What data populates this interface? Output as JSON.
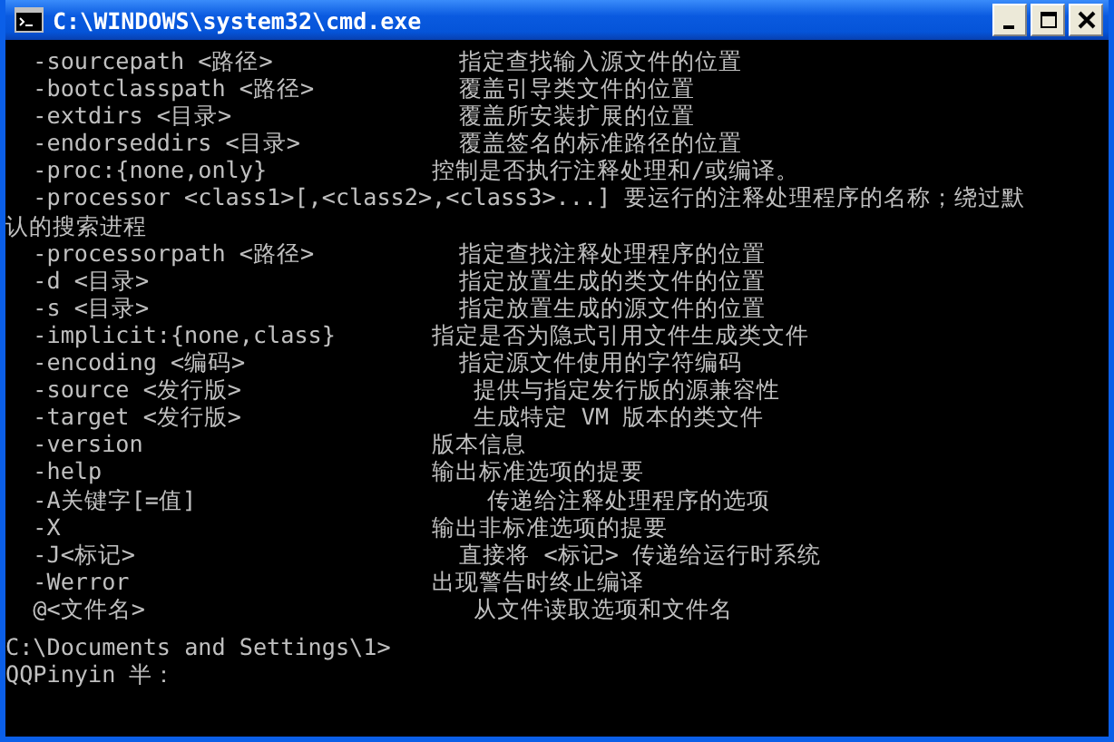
{
  "window": {
    "title": "C:\\WINDOWS\\system32\\cmd.exe"
  },
  "lines": [
    {
      "kind": "option",
      "option": "-sourcepath <路径>",
      "description": "  指定查找输入源文件的位置"
    },
    {
      "kind": "option",
      "option": "-bootclasspath <路径>",
      "description": "  覆盖引导类文件的位置"
    },
    {
      "kind": "option",
      "option": "-extdirs <目录>",
      "description": "  覆盖所安装扩展的位置"
    },
    {
      "kind": "option",
      "option": "-endorseddirs <目录>",
      "description": "  覆盖签名的标准路径的位置"
    },
    {
      "kind": "option",
      "option": "-proc:{none,only}",
      "description": "控制是否执行注释处理和/或编译。"
    },
    {
      "kind": "wrap",
      "option": "-processor <class1>[,<class2>,<class3>...]",
      "description": "要运行的注释处理程序的名称；绕过默",
      "continuation": "认的搜索进程"
    },
    {
      "kind": "option",
      "option": "-processorpath <路径>",
      "description": "  指定查找注释处理程序的位置"
    },
    {
      "kind": "option",
      "option": "-d <目录>",
      "description": "  指定放置生成的类文件的位置"
    },
    {
      "kind": "option",
      "option": "-s <目录>",
      "description": "  指定放置生成的源文件的位置"
    },
    {
      "kind": "option",
      "option": "-implicit:{none,class}",
      "description": "指定是否为隐式引用文件生成类文件"
    },
    {
      "kind": "option",
      "option": "-encoding <编码>",
      "description": "  指定源文件使用的字符编码"
    },
    {
      "kind": "option",
      "option": "-source <发行版>",
      "description": "   提供与指定发行版的源兼容性"
    },
    {
      "kind": "option",
      "option": "-target <发行版>",
      "description": "   生成特定 VM 版本的类文件"
    },
    {
      "kind": "option",
      "option": "-version",
      "description": "版本信息"
    },
    {
      "kind": "option",
      "option": "-help",
      "description": "输出标准选项的提要"
    },
    {
      "kind": "option",
      "option": "-A关键字[=值]",
      "description": "    传递给注释处理程序的选项"
    },
    {
      "kind": "option",
      "option": "-X",
      "description": "输出非标准选项的提要"
    },
    {
      "kind": "option",
      "option": "-J<标记>",
      "description": "  直接将 <标记> 传递给运行时系统"
    },
    {
      "kind": "option",
      "option": "-Werror",
      "description": "出现警告时终止编译"
    },
    {
      "kind": "option",
      "option": "@<文件名>",
      "description": "   从文件读取选项和文件名"
    }
  ],
  "prompt": "C:\\Documents and Settings\\1>",
  "ime_status": "QQPinyin 半："
}
